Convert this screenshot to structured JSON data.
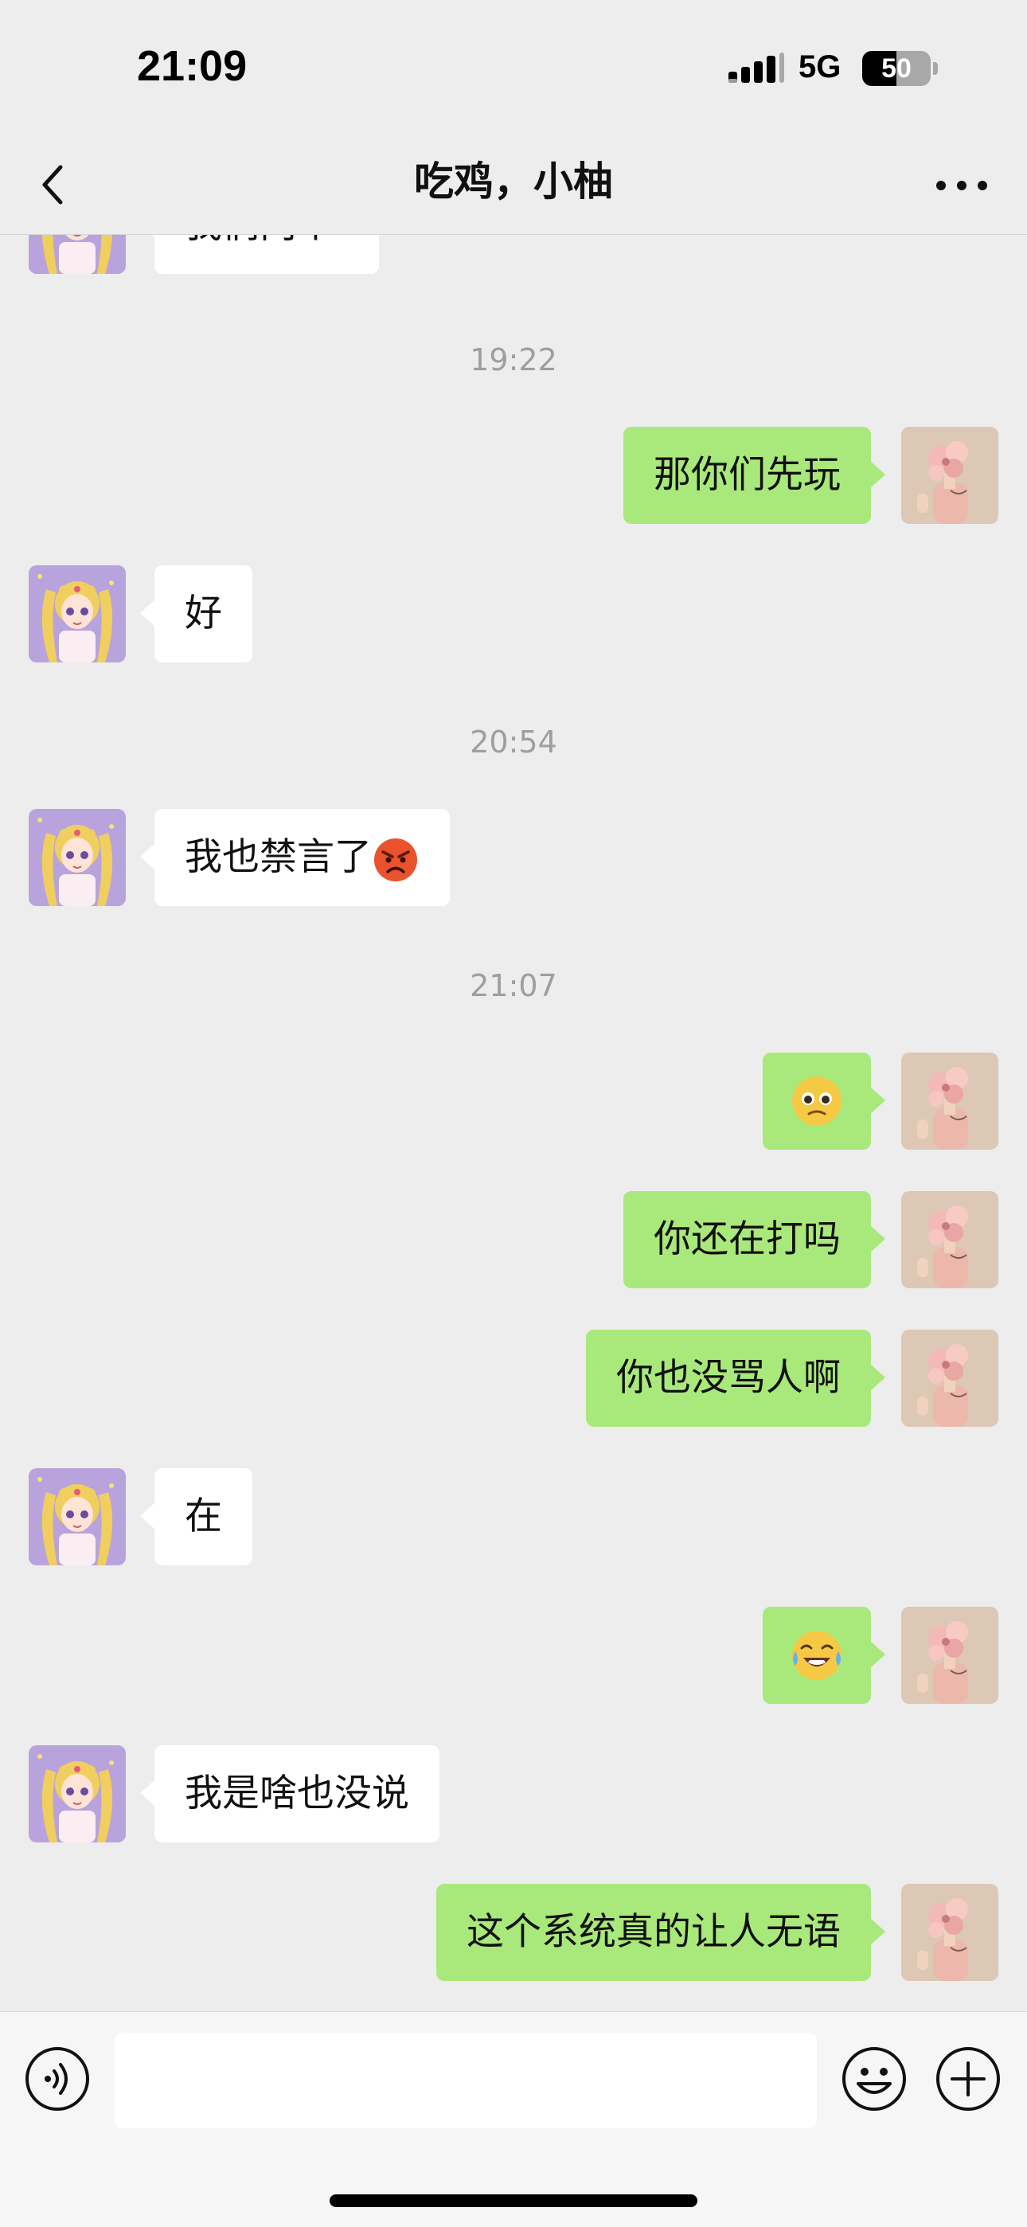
{
  "status_bar": {
    "time": "21:09",
    "network": "5G",
    "battery_level": "50",
    "battery_fraction": 0.5
  },
  "header": {
    "title": "吃鸡，小柚",
    "back_icon": "chevron-left-icon",
    "more_icon": "more-horizontal-icon"
  },
  "messages": {
    "m0_text": "我们两个",
    "t1": "19:22",
    "m1_text": "那你们先玩",
    "m2_text": "好",
    "t2": "20:54",
    "m3_text": "我也禁言了",
    "m3_emoji": "angry-face-emoji",
    "t3": "21:07",
    "m4_emoji": "pleading-face-emoji",
    "m5_text": "你还在打吗",
    "m6_text": "你也没骂人啊",
    "m7_text": "在",
    "m8_emoji": "rolling-laughing-crying-emoji",
    "m9_text": "我是啥也没说",
    "m10_text": "这个系统真的让人无语"
  },
  "input_bar": {
    "voice_icon": "voice-icon",
    "emoji_icon": "smiley-icon",
    "plus_icon": "plus-icon",
    "text_value": ""
  },
  "colors": {
    "background": "#ededed",
    "outgoing_bubble": "#a9e97b",
    "incoming_bubble": "#ffffff",
    "timestamp": "#9e9e9e"
  }
}
